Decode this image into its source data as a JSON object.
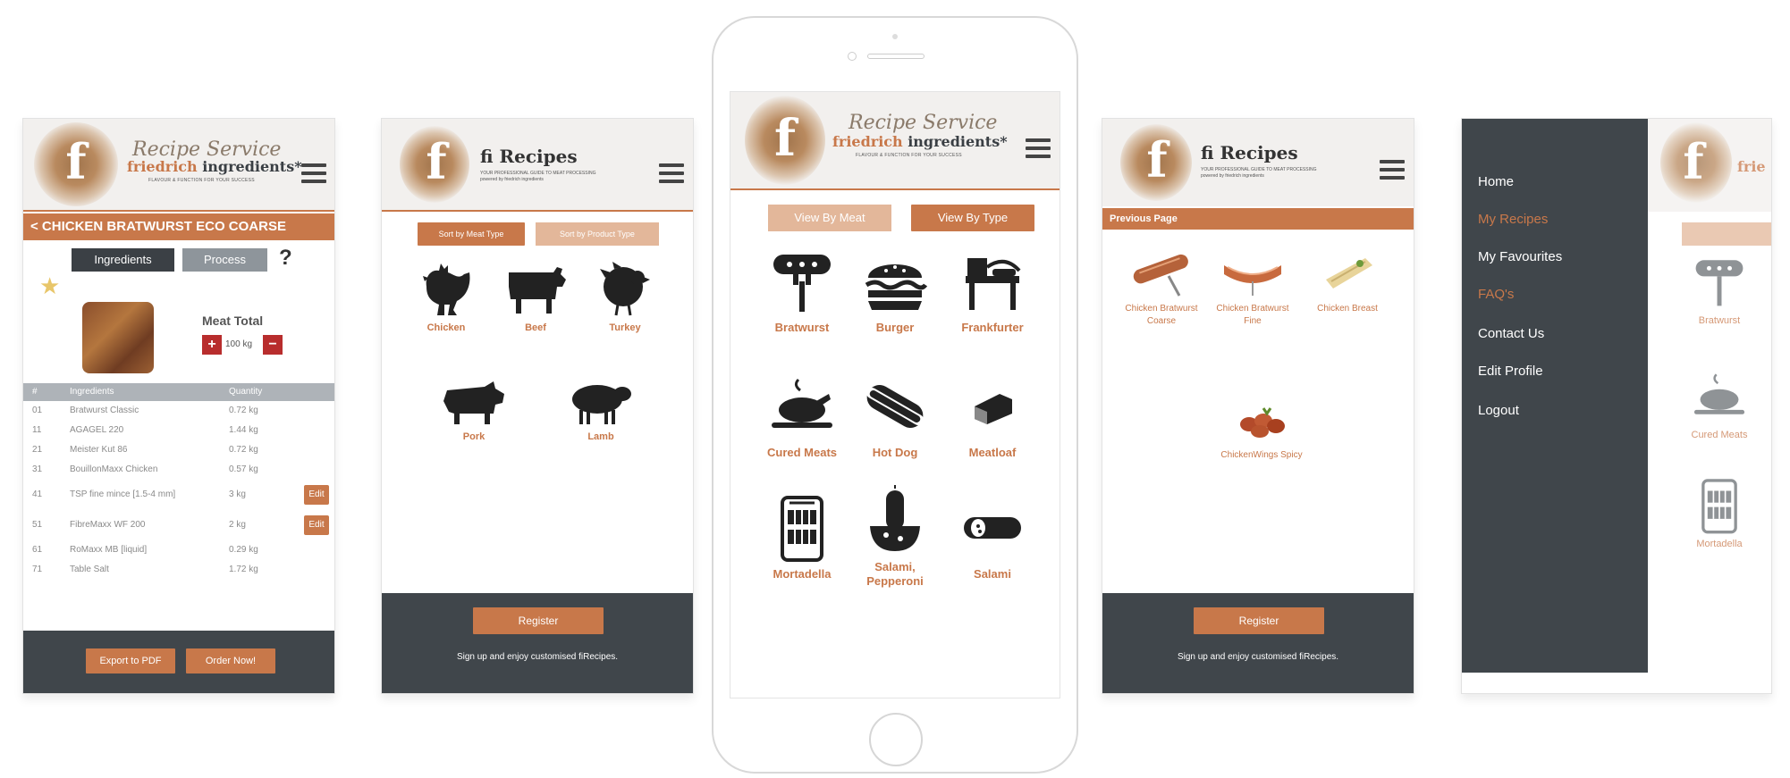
{
  "screen1": {
    "title": "< CHICKEN BRATWURST ECO COARSE",
    "brand_script": "Recipe Service",
    "brand_name_a": "friedrich",
    "brand_name_b": "ingredients*",
    "brand_tagline": "FLAVOUR & FUNCTION FOR YOUR SUCCESS",
    "tabs": [
      "Ingredients",
      "Process"
    ],
    "help": "?",
    "star_icon": "star-icon",
    "meat_total_label": "Meat Total",
    "meat_total_value": "100 kg",
    "table_headers": [
      "#",
      "Ingredients",
      "Quantity"
    ],
    "rows": [
      {
        "num": "01",
        "name": "Bratwurst Classic",
        "qty": "0.72 kg"
      },
      {
        "num": "11",
        "name": "AGAGEL 220",
        "qty": "1.44 kg"
      },
      {
        "num": "21",
        "name": "Meister Kut 86",
        "qty": "0.72 kg"
      },
      {
        "num": "31",
        "name": "BouillonMaxx Chicken",
        "qty": "0.57 kg"
      },
      {
        "num": "41",
        "name": "TSP fine mince [1.5-4 mm]",
        "qty": "3 kg",
        "edit": "Edit"
      },
      {
        "num": "51",
        "name": "FibreMaxx WF 200",
        "qty": "2 kg",
        "edit": "Edit"
      },
      {
        "num": "61",
        "name": "RoMaxx MB [liquid]",
        "qty": "0.29 kg"
      },
      {
        "num": "71",
        "name": "Table Salt",
        "qty": "1.72 kg"
      }
    ],
    "export_btn": "Export to PDF",
    "order_btn": "Order Now!"
  },
  "screen2": {
    "fi_title": "fi Recipes",
    "fi_sub1": "YOUR PROFESSIONAL GUIDE TO MEAT PROCESSING",
    "fi_sub2": "powered by friedrich ingredients",
    "sort_meat": "Sort by Meat Type",
    "sort_product": "Sort by Product Type",
    "items": [
      {
        "label": "Chicken",
        "icon": "chicken-icon"
      },
      {
        "label": "Beef",
        "icon": "cow-icon"
      },
      {
        "label": "Turkey",
        "icon": "turkey-icon"
      },
      {
        "label": "Pork",
        "icon": "pig-icon"
      },
      {
        "label": "Lamb",
        "icon": "sheep-icon"
      }
    ],
    "register_btn": "Register",
    "signup_text": "Sign up and enjoy customised fiRecipes."
  },
  "screen3": {
    "brand_script": "Recipe Service",
    "brand_name_a": "friedrich",
    "brand_name_b": "ingredients*",
    "brand_tagline": "FLAVOUR & FUNCTION FOR YOUR SUCCESS",
    "view_meat": "View By Meat",
    "view_type": "View By Type",
    "items": [
      {
        "label": "Bratwurst",
        "icon": "bratwurst-icon"
      },
      {
        "label": "Burger",
        "icon": "burger-icon"
      },
      {
        "label": "Frankfurter",
        "icon": "frankfurter-machine-icon"
      },
      {
        "label": "Cured Meats",
        "icon": "roast-chicken-icon"
      },
      {
        "label": "Hot Dog",
        "icon": "hot-dog-icon"
      },
      {
        "label": "Meatloaf",
        "icon": "meatloaf-icon"
      },
      {
        "label": "Mortadella",
        "icon": "mortadella-icon"
      },
      {
        "label": "Salami, Pepperoni",
        "icon": "salami-icon"
      },
      {
        "label": "Salami",
        "icon": "salami-stick-icon"
      }
    ]
  },
  "screen4": {
    "fi_title": "fi Recipes",
    "fi_sub1": "YOUR PROFESSIONAL GUIDE TO MEAT PROCESSING",
    "fi_sub2": "powered by friedrich ingredients",
    "previous": "Previous Page",
    "items": [
      {
        "label": "Chicken Bratwurst Coarse"
      },
      {
        "label": "Chicken Bratwurst Fine"
      },
      {
        "label": "Chicken Breast"
      },
      {
        "label": "ChickenWings Spicy"
      }
    ],
    "register_btn": "Register",
    "signup_text": "Sign up and enjoy customised fiRecipes."
  },
  "screen5": {
    "menu": [
      {
        "label": "Home",
        "active": false
      },
      {
        "label": "My Recipes",
        "active": true
      },
      {
        "label": "My Favourites",
        "active": false
      },
      {
        "label": "FAQ's",
        "active": true
      },
      {
        "label": "Contact Us",
        "active": false
      },
      {
        "label": "Edit Profile",
        "active": false
      },
      {
        "label": "Logout",
        "active": false
      }
    ],
    "peek_items": [
      "Bratwurst",
      "Cured Meats",
      "Mortadella"
    ],
    "peek_brand": "frie"
  },
  "colors": {
    "accent": "#c8784a",
    "dark": "#40464b",
    "tab_dark": "#3b4045",
    "tab_grey": "#8e959b"
  }
}
